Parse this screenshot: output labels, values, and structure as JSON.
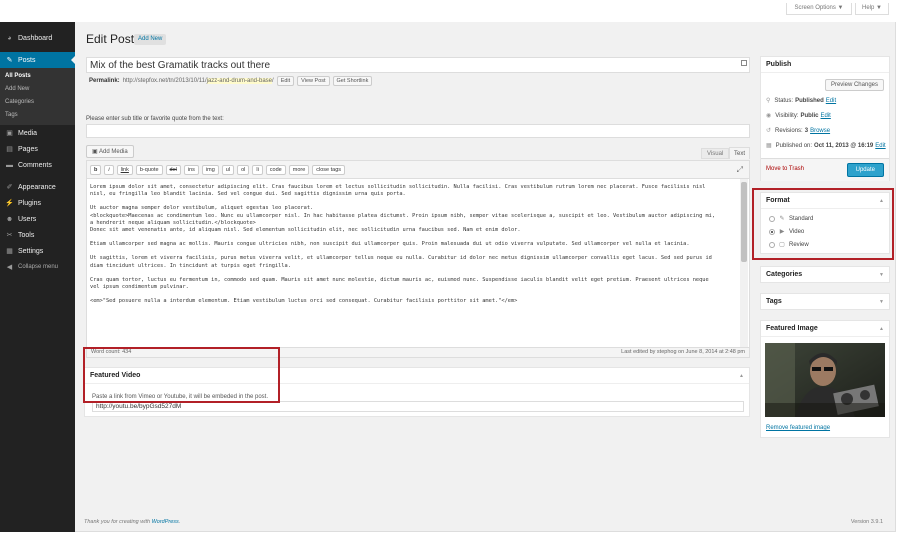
{
  "sidebar": {
    "dashboard": "Dashboard",
    "posts": "Posts",
    "submenu": [
      "All Posts",
      "Add New",
      "Categories",
      "Tags"
    ],
    "media": "Media",
    "pages": "Pages",
    "comments": "Comments",
    "appearance": "Appearance",
    "plugins": "Plugins",
    "users": "Users",
    "tools": "Tools",
    "settings": "Settings",
    "collapse": "Collapse menu"
  },
  "screen_options": "Screen Options ▼",
  "help": "Help ▼",
  "header": {
    "title": "Edit Post",
    "add_new": "Add New"
  },
  "post": {
    "title": "Mix of the best Gramatik tracks out there",
    "permalink_label": "Permalink:",
    "permalink_base": "http://stepfox.net/tn/2013/10/11/",
    "permalink_slug": "jazz-and-drum-and-base",
    "permalink_tail": "/",
    "edit_btn": "Edit",
    "view_btn": "View Post",
    "shortlink_btn": "Get Shortlink"
  },
  "subtitle": {
    "label": "Please enter sub title or favorite quote from the text:",
    "value": ""
  },
  "editor": {
    "add_media": "Add Media",
    "tab_visual": "Visual",
    "tab_text": "Text",
    "quicktags": [
      "b",
      "i",
      "link",
      "b-quote",
      "del",
      "ins",
      "img",
      "ul",
      "ol",
      "li",
      "code",
      "more",
      "close tags"
    ],
    "content": [
      "Lorem ipsum dolor sit amet, consectetur adipiscing elit. Cras faucibus lorem et lectus sollicitudin sollicitudin. Nulla facilisi. Cras vestibulum rutrum lorem nec placerat. Fusce facilisis nisl\nnisl, eu fringilla leo blandit lacinia. Sed vel congue dui. Sed sagittis dignissim urna quis porta.",
      "Ut auctor magna semper dolor vestibulum, aliquet egestas leo placerat.\n<blockquote>Maecenas ac condimentum leo. Nunc eu ullamcorper nisl. In hac habitasse platea dictumst. Proin ipsum nibh, semper vitae scelerisque a, suscipit et leo. Vestibulum auctor adipiscing mi,\na hendrerit neque aliquam sollicitudin.</blockquote>\nDonec sit amet venenatis ante, id aliquam nisl. Sed elementum sollicitudin elit, nec sollicitudin urna faucibus sed. Nam et enim dolor.",
      "Etiam ullamcorper sed magna ac mollis. Mauris congue ultricies nibh, non suscipit dui ullamcorper quis. Proin malesuada dui ut odio viverra vulputate. Sed ullamcorper vel nulla et lacinia.",
      "Ut sagittis, lorem et viverra facilisis, purus metus viverra velit, et ullamcorper tellus neque eu nulla. Curabitur id dolor nec metus dignissim ullamcorper convallis eget lacus. Sed sed purus id\ndiam tincidunt ultrices. In tincidunt at turpis eget fringilla.",
      "Cras quam tortor, luctus eu fermentum in, commodo sed quam. Mauris sit amet nunc molestie, dictum mauris ac, euismod nunc. Suspendisse iaculis blandit velit eget pretium. Praesent ultrices neque\nvel ipsum condimentum pulvinar.",
      "<em>\"Sed posuere nulla a interdum elementum. Etiam vestibulum luctus orci sed consequat. Curabitur facilisis porttitor sit amet.\"</em>"
    ],
    "word_count": "Word count: 434",
    "last_edited": "Last edited by stephog on June 8, 2014 at 2:48 pm"
  },
  "featured_video": {
    "title": "Featured Video",
    "help": "Paste a link from Vimeo or Youtube, it will be embeded in the post.",
    "value": "http://youtu.be/bypGsd527dM"
  },
  "publish": {
    "title": "Publish",
    "preview": "Preview Changes",
    "status_label": "Status:",
    "status_value": "Published",
    "visibility_label": "Visibility:",
    "visibility_value": "Public",
    "revisions_label": "Revisions:",
    "revisions_value": "3",
    "browse": "Browse",
    "published_label": "Published on:",
    "published_value": "Oct 11, 2013 @ 16:19",
    "edit": "Edit",
    "trash": "Move to Trash",
    "update": "Update"
  },
  "format": {
    "title": "Format",
    "options": [
      "Standard",
      "Video",
      "Review"
    ],
    "selected": "Video"
  },
  "categories": {
    "title": "Categories"
  },
  "tags": {
    "title": "Tags"
  },
  "featured_image": {
    "title": "Featured Image",
    "remove": "Remove featured image"
  },
  "footer": {
    "thanks": "Thank you for creating with ",
    "wp": "WordPress",
    "dot": ".",
    "version": "Version 3.9.1"
  },
  "colors": {
    "highlight": "#b22027",
    "admin_bar": "#222222",
    "active": "#0074a2"
  }
}
